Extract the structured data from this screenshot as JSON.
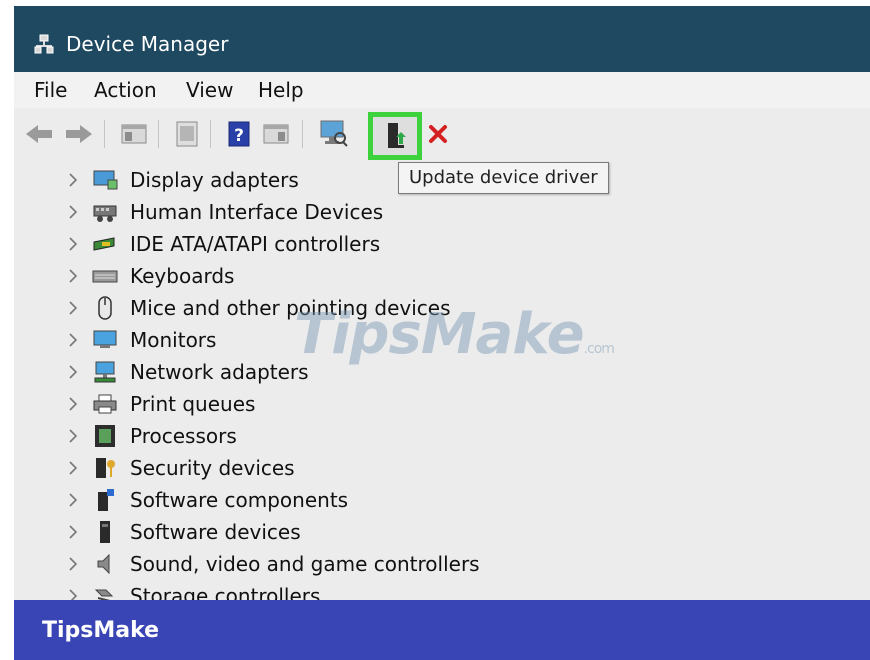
{
  "window": {
    "title": "Device Manager",
    "icon": "device-manager-icon"
  },
  "menu": [
    {
      "label": "File"
    },
    {
      "label": "Action"
    },
    {
      "label": "View"
    },
    {
      "label": "Help"
    }
  ],
  "toolbar": {
    "buttons": [
      {
        "icon": "back-arrow-icon"
      },
      {
        "icon": "forward-arrow-icon"
      },
      {
        "icon": "show-hide-console-tree-icon"
      },
      {
        "icon": "properties-icon"
      },
      {
        "icon": "help-icon"
      },
      {
        "icon": "action-pane-icon"
      },
      {
        "icon": "scan-hardware-icon"
      },
      {
        "icon": "update-driver-icon"
      },
      {
        "icon": "uninstall-device-icon"
      }
    ],
    "highlight_color": "#3cd23c",
    "tooltip": "Update device driver"
  },
  "tree": {
    "items": [
      {
        "label": "Display adapters",
        "icon": "display-adapter-icon"
      },
      {
        "label": "Human Interface Devices",
        "icon": "hid-icon"
      },
      {
        "label": "IDE ATA/ATAPI controllers",
        "icon": "ide-controller-icon"
      },
      {
        "label": "Keyboards",
        "icon": "keyboard-icon"
      },
      {
        "label": "Mice and other pointing devices",
        "icon": "mouse-icon"
      },
      {
        "label": "Monitors",
        "icon": "monitor-icon"
      },
      {
        "label": "Network adapters",
        "icon": "network-adapter-icon"
      },
      {
        "label": "Print queues",
        "icon": "printer-icon"
      },
      {
        "label": "Processors",
        "icon": "processor-icon"
      },
      {
        "label": "Security devices",
        "icon": "security-device-icon"
      },
      {
        "label": "Software components",
        "icon": "software-component-icon"
      },
      {
        "label": "Software devices",
        "icon": "software-device-icon"
      },
      {
        "label": "Sound, video and game controllers",
        "icon": "speaker-icon"
      },
      {
        "label": "Storage controllers",
        "icon": "storage-controller-icon"
      }
    ]
  },
  "watermark": {
    "text": "TipsMake",
    "suffix": ".com"
  },
  "footer": {
    "brand": "TipsMake",
    "color": "#3a45b5"
  },
  "colors": {
    "titlebar": "#1f4861",
    "window_bg": "#ececec"
  }
}
